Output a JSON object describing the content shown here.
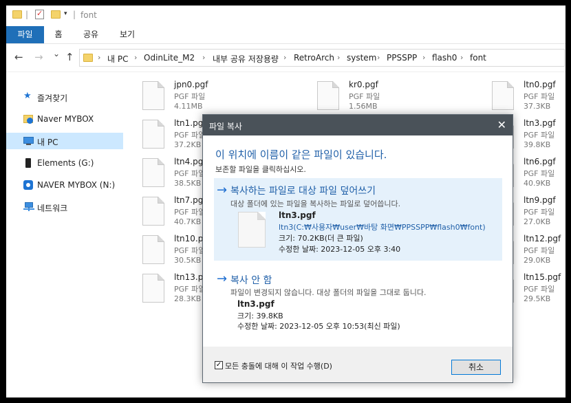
{
  "titlebar": {
    "title": "font",
    "separator": "|"
  },
  "ribbon": {
    "tabs": [
      "파일",
      "홈",
      "공유",
      "보기"
    ]
  },
  "nav": {
    "back": "←",
    "forward": "→",
    "recent": "⌄",
    "up": "↑"
  },
  "address": {
    "crumbs": [
      "내 PC",
      "OdinLite_M2",
      "내부 공유 저장용량",
      "RetroArch",
      "system",
      "PPSSPP",
      "flash0",
      "font"
    ],
    "separator": "›"
  },
  "sidebar": {
    "items": [
      {
        "label": "즐겨찾기",
        "icon": "star-icon"
      },
      {
        "label": "Naver MYBOX",
        "icon": "mybox-folder-icon"
      },
      {
        "label": "내 PC",
        "icon": "pc-icon"
      },
      {
        "label": "Elements (G:)",
        "icon": "drive-icon"
      },
      {
        "label": "NAVER MYBOX (N:)",
        "icon": "mybox-drive-icon"
      },
      {
        "label": "네트워크",
        "icon": "network-icon"
      }
    ]
  },
  "files": [
    {
      "name": "jpn0.pgf",
      "type": "PGF 파일",
      "size": "4.11MB"
    },
    {
      "name": "kr0.pgf",
      "type": "PGF 파일",
      "size": "1.56MB"
    },
    {
      "name": "ltn0.pgf",
      "type": "PGF 파일",
      "size": "37.3KB"
    },
    {
      "name": "ltn1.pgf",
      "type": "PGF 파일",
      "size": "37.2KB"
    },
    {
      "name": "ltn3.pgf",
      "type": "PGF 파일",
      "size": "39.8KB"
    },
    {
      "name": "ltn4.pgf",
      "type": "PGF 파일",
      "size": "38.5KB"
    },
    {
      "name": "ltn6.pgf",
      "type": "PGF 파일",
      "size": "40.9KB"
    },
    {
      "name": "ltn7.pgf",
      "type": "PGF 파일",
      "size": "40.7KB"
    },
    {
      "name": "ltn9.pgf",
      "type": "PGF 파일",
      "size": "27.0KB"
    },
    {
      "name": "ltn10.pgf",
      "type": "PGF 파일",
      "size": "30.5KB"
    },
    {
      "name": "ltn12.pgf",
      "type": "PGF 파일",
      "size": "29.0KB"
    },
    {
      "name": "ltn13.pgf",
      "type": "PGF 파일",
      "size": "28.3KB"
    },
    {
      "name": "ltn15.pgf",
      "type": "PGF 파일",
      "size": "29.5KB"
    }
  ],
  "dialog": {
    "title": "파일 복사",
    "close": "✕",
    "heading": "이 위치에 이름이 같은 파일이 있습니다.",
    "subheading": "보존할 파일을 클릭하십시오.",
    "option_replace": {
      "arrow": "→",
      "title": "복사하는 파일로 대상 파일 덮어쓰기",
      "desc": "대상 폴더에 있는 파일을 복사하는 파일로 덮어씁니다.",
      "file_name": "ltn3.pgf",
      "file_path": "ltn3(C:₩사용자₩user₩바탕 화면₩PPSSPP₩flash0₩font)",
      "size": "크기: 70.2KB(더 큰 파일)",
      "modified": "수정한 날짜: 2023-12-05 오후 3:40"
    },
    "option_skip": {
      "arrow": "→",
      "title": "복사 안 함",
      "desc": "파일이 변경되지 않습니다. 대상 폴더의 파일을 그대로 둡니다.",
      "file_name": "ltn3.pgf",
      "size": "크기: 39.8KB",
      "modified": "수정한 날짜: 2023-12-05 오후 10:53(최신 파일)"
    },
    "apply_all": {
      "label": "모든 충돌에 대해 이 작업 수행(D)",
      "checked": "✓"
    },
    "cancel": "취소"
  }
}
